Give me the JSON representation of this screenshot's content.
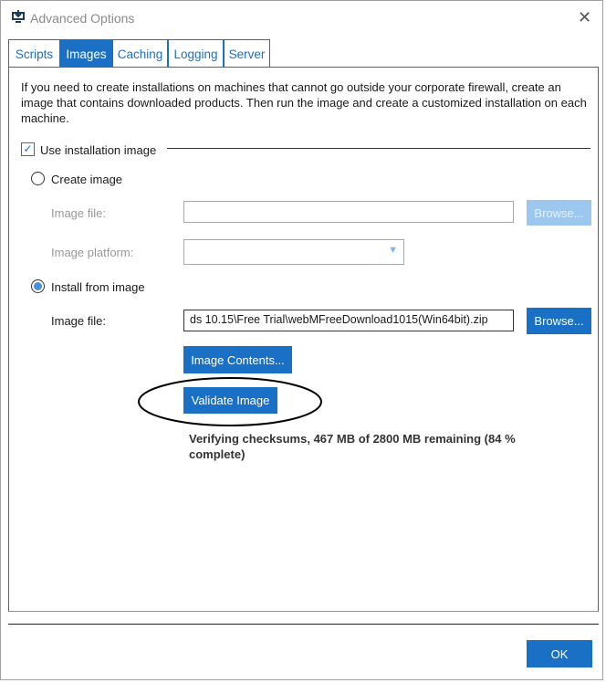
{
  "window": {
    "title": "Advanced Options",
    "close_icon": "close-icon",
    "app_icon": "download-monitor-icon"
  },
  "tabs": [
    {
      "label": "Scripts"
    },
    {
      "label": "Images",
      "active": true
    },
    {
      "label": "Caching"
    },
    {
      "label": "Logging"
    },
    {
      "label": "Server"
    }
  ],
  "images": {
    "intro": "If you need to create installations on machines that cannot go outside your corporate firewall, create an image that contains downloaded products. Then run the image and create a customized installation on each machine.",
    "use_image_label": "Use installation image",
    "use_image_checked": true,
    "create": {
      "label": "Create image",
      "selected": false,
      "file_label": "Image file:",
      "file_value": "",
      "browse": "Browse...",
      "platform_label": "Image platform:",
      "platform_value": ""
    },
    "install": {
      "label": "Install from image",
      "selected": true,
      "file_label": "Image file:",
      "file_value": "ds 10.15\\Free Trial\\webMFreeDownload1015(Win64bit).zip",
      "browse": "Browse..."
    },
    "contents_button": "Image Contents...",
    "validate_button": "Validate Image",
    "status": "Verifying checksums, 467 MB of 2800 MB remaining (84 % complete)",
    "progress_percent": 84
  },
  "footer": {
    "ok": "OK"
  },
  "colors": {
    "accent": "#1a70c4",
    "disabled": "#9cc8ef"
  }
}
